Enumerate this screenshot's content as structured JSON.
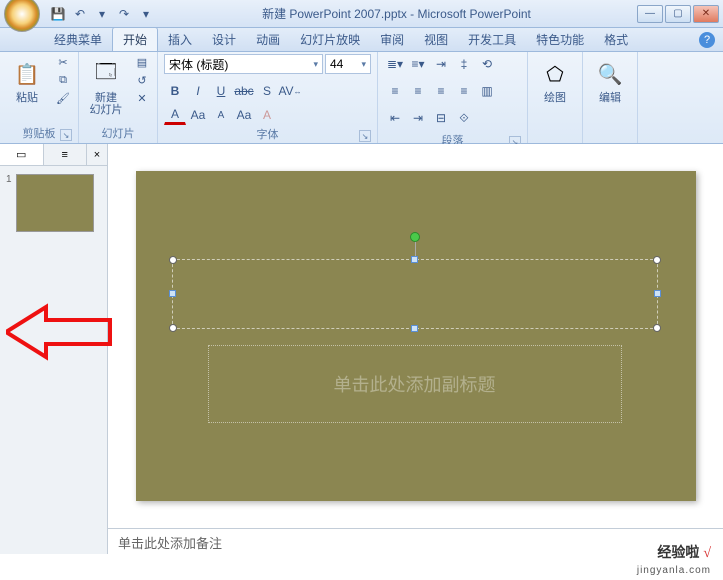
{
  "window": {
    "title": "新建 PowerPoint 2007.pptx - Microsoft PowerPoint"
  },
  "qat": {
    "save": "💾",
    "undo": "↶",
    "redo": "↷",
    "dd": "▾"
  },
  "tabs": {
    "classic": "经典菜单",
    "home": "开始",
    "insert": "插入",
    "design": "设计",
    "animations": "动画",
    "slideshow": "幻灯片放映",
    "review": "审阅",
    "view": "视图",
    "developer": "开发工具",
    "special": "特色功能",
    "format": "格式"
  },
  "ribbon": {
    "clipboard": {
      "label": "剪贴板",
      "paste": "粘贴"
    },
    "slides": {
      "label": "幻灯片",
      "new_slide": "新建\n幻灯片"
    },
    "font": {
      "label": "字体",
      "name": "宋体 (标题)",
      "size": "44",
      "bold": "B",
      "italic": "I",
      "underline": "U",
      "strike": "abc",
      "shadow": "S",
      "spacing": "AV",
      "color": "A",
      "grow": "Aa",
      "shrink": "A",
      "case": "Aa",
      "clear": "A"
    },
    "paragraph": {
      "label": "段落"
    },
    "drawing": {
      "label": "绘图"
    },
    "editing": {
      "label": "编辑"
    }
  },
  "slidepanel": {
    "tab_slides_icon": "▭",
    "tab_outline_icon": "≡",
    "close": "×",
    "thumb_num": "1"
  },
  "slide": {
    "subtitle_placeholder": "单击此处添加副标题"
  },
  "notes": {
    "placeholder": "单击此处添加备注"
  },
  "watermark": {
    "text": "经验啦",
    "mark": "√",
    "url": "jingyanla.com"
  }
}
